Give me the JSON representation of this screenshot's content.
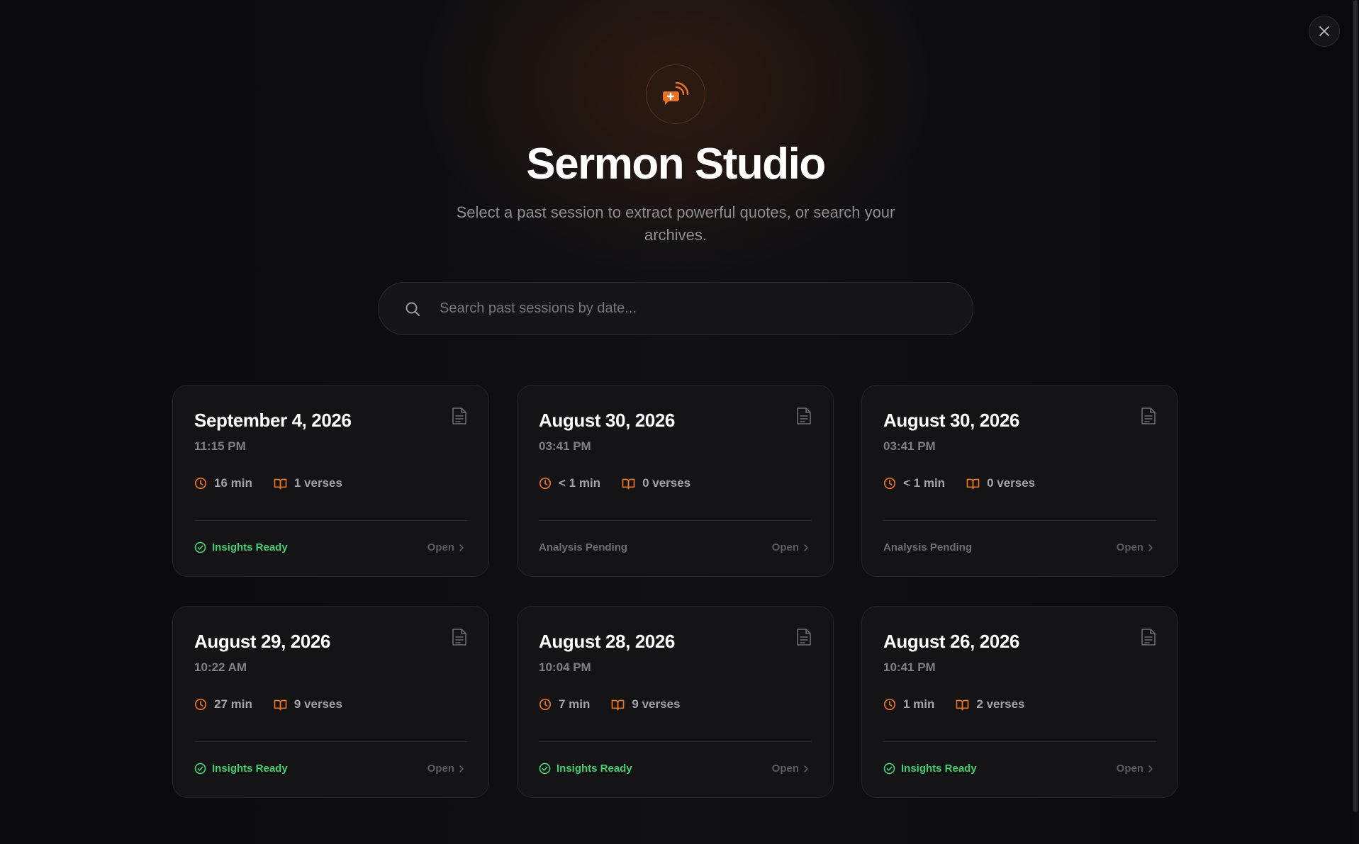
{
  "header": {
    "title": "Sermon Studio",
    "subtitle": "Select a past session to extract powerful quotes, or search your archives."
  },
  "search": {
    "placeholder": "Search past sessions by date...",
    "value": ""
  },
  "colors": {
    "accent": "#e8731f",
    "ready": "#3ecf6e",
    "pending": "#6e6e75"
  },
  "icons": {
    "logo": "podcast-plus-icon",
    "close": "close-icon",
    "search": "search-icon",
    "document": "document-icon",
    "clock": "clock-icon",
    "book": "book-icon",
    "check": "check-circle-icon",
    "chevron": "chevron-right-icon"
  },
  "sessions": [
    {
      "date": "September 4, 2026",
      "time": "11:15 PM",
      "duration": "16 min",
      "verses": "1 verses",
      "status": "Insights Ready",
      "ready": true,
      "open": "Open"
    },
    {
      "date": "August 30, 2026",
      "time": "03:41 PM",
      "duration": "< 1 min",
      "verses": "0 verses",
      "status": "Analysis Pending",
      "ready": false,
      "open": "Open"
    },
    {
      "date": "August 30, 2026",
      "time": "03:41 PM",
      "duration": "< 1 min",
      "verses": "0 verses",
      "status": "Analysis Pending",
      "ready": false,
      "open": "Open"
    },
    {
      "date": "August 29, 2026",
      "time": "10:22 AM",
      "duration": "27 min",
      "verses": "9 verses",
      "status": "Insights Ready",
      "ready": true,
      "open": "Open"
    },
    {
      "date": "August 28, 2026",
      "time": "10:04 PM",
      "duration": "7 min",
      "verses": "9 verses",
      "status": "Insights Ready",
      "ready": true,
      "open": "Open"
    },
    {
      "date": "August 26, 2026",
      "time": "10:41 PM",
      "duration": "1 min",
      "verses": "2 verses",
      "status": "Insights Ready",
      "ready": true,
      "open": "Open"
    }
  ]
}
